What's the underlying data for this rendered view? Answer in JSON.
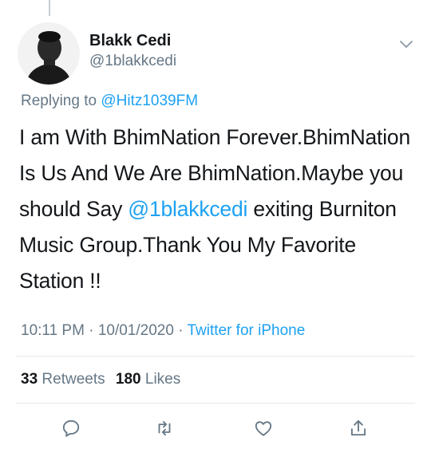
{
  "user": {
    "name": "Blakk Cedi",
    "handle": "@1blakkcedi"
  },
  "reply": {
    "prefix": "Replying to",
    "mention": "@Hitz1039FM"
  },
  "tweet": {
    "text_part1": "I am With BhimNation Forever.BhimNation Is Us And We Are BhimNation.Maybe you should Say ",
    "mention": "@1blakkcedi",
    "text_part2": " exiting Burniton Music Group.Thank You My Favorite Station !!"
  },
  "meta": {
    "time": "10:11 PM",
    "date": "10/01/2020",
    "separator": "·",
    "source": "Twitter for iPhone"
  },
  "stats": {
    "retweets_count": "33",
    "retweets_label": "Retweets",
    "likes_count": "180",
    "likes_label": "Likes"
  },
  "icons": {
    "more": "chevron-down-icon",
    "reply": "reply-icon",
    "retweet": "retweet-icon",
    "like": "heart-icon",
    "share": "share-icon"
  },
  "colors": {
    "link": "#1da1f2",
    "secondary": "#657786",
    "text": "#14171a"
  }
}
